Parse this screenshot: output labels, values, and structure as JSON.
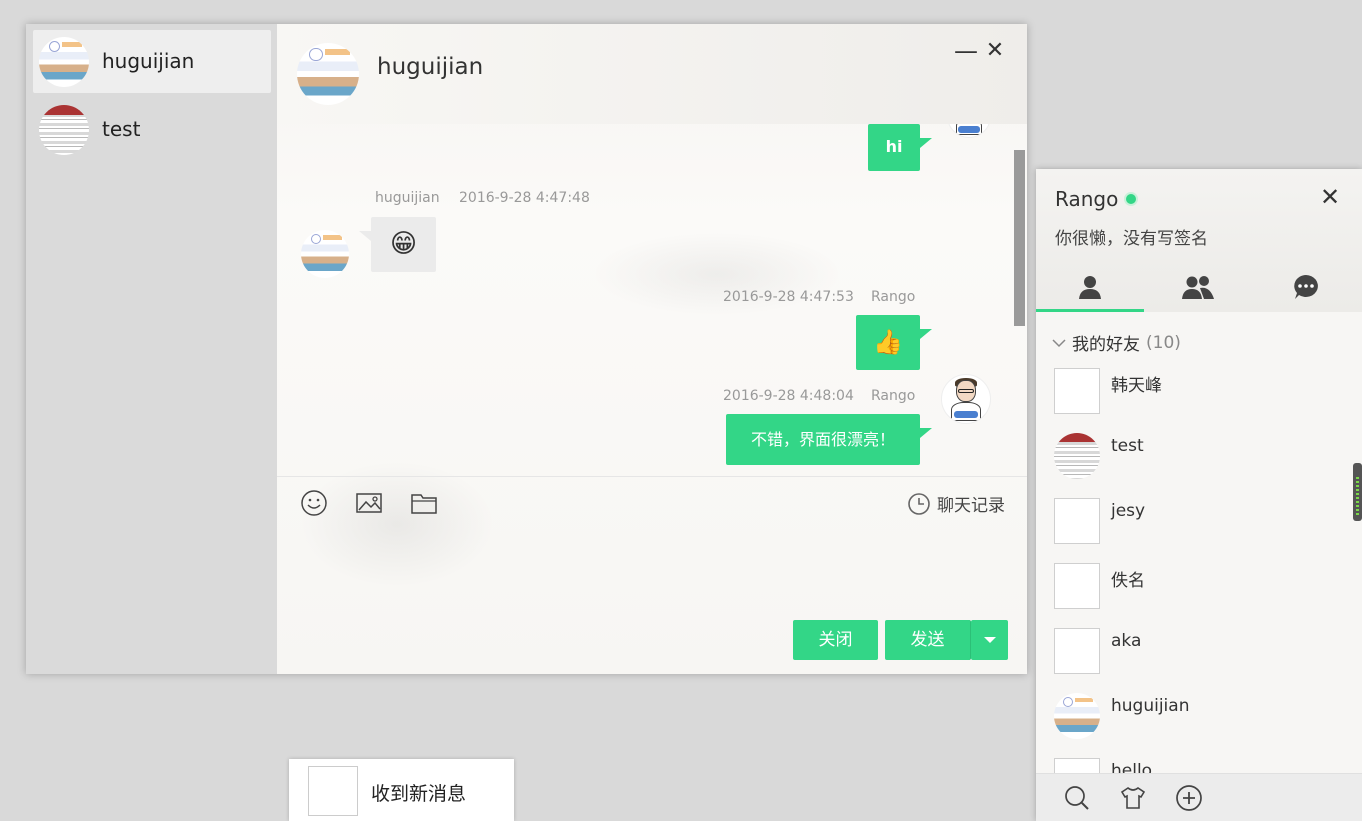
{
  "conversations": [
    {
      "name": "huguijian",
      "active": true
    },
    {
      "name": "test",
      "active": false
    }
  ],
  "chat": {
    "title": "huguijian",
    "minimize": "—",
    "close": "✕",
    "messages": [
      {
        "side": "right",
        "text": "hi"
      },
      {
        "side": "left",
        "sender": "huguijian",
        "time": "2016-9-28 4:47:48",
        "text": "😁"
      },
      {
        "side": "right",
        "sender": "Rango",
        "time": "2016-9-28 4:47:53",
        "text": "👍"
      },
      {
        "side": "right",
        "sender": "Rango",
        "time": "2016-9-28 4:48:04",
        "text": "不错，界面很漂亮！"
      }
    ],
    "history_label": "聊天记录",
    "close_button": "关闭",
    "send_button": "发送"
  },
  "buddy": {
    "user": "Rango",
    "signature": "你很懒，没有写签名",
    "close": "✕",
    "tabs": [
      "contacts-icon",
      "groups-icon",
      "chat-icon"
    ],
    "group": {
      "name": "我的好友",
      "count": "(10)"
    },
    "friends": [
      "韩天峰",
      "test",
      "jesy",
      "佚名",
      "aka",
      "huguijian",
      "hello"
    ]
  },
  "notification": {
    "text": "收到新消息"
  },
  "colors": {
    "accent": "#33d687",
    "sidebar": "#dadada"
  }
}
